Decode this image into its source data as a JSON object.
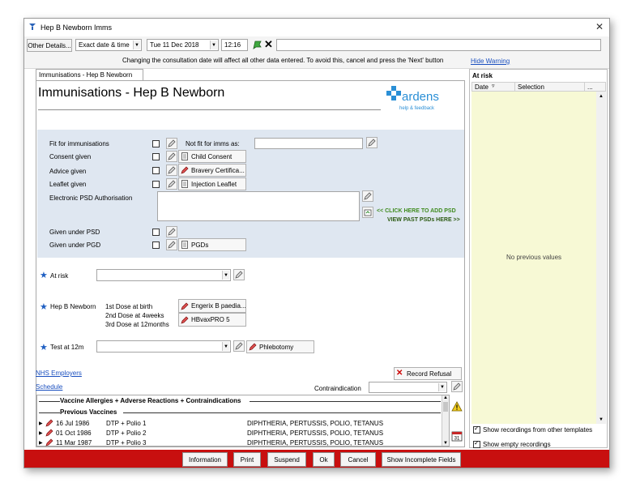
{
  "window": {
    "title": "Hep B Newborn Imms"
  },
  "toolbar": {
    "other_details": "Other Details...",
    "date_mode": "Exact date & time",
    "date": "Tue 11 Dec 2018",
    "time": "12:16",
    "warning": "Changing the consultation date will affect all other data entered. To avoid this, cancel and press the 'Next' button",
    "hide_warning": "Hide Warning"
  },
  "tab": {
    "label": "Immunisations - Hep B Newborn"
  },
  "main": {
    "heading": "Immunisations - Hep B Newborn",
    "brand": {
      "name": "ardens",
      "tagline": "help & feedback"
    },
    "fields": {
      "fit": "Fit for immunisations",
      "not_fit": "Not fit for imms as:",
      "consent": "Consent given",
      "advice": "Advice given",
      "leaflet": "Leaflet given",
      "eauth": "Electronic PSD Authorisation",
      "psd": "Given under PSD",
      "pgd": "Given under PGD"
    },
    "buttons": {
      "child_consent": "Child Consent",
      "bravery": "Bravery Certifica...",
      "injection": "Injection Leaflet",
      "pgds": "PGDs",
      "engerix": "Engerix B paedia...",
      "hbvax": "HBvaxPRO 5",
      "phlebotomy": "Phlebotomy",
      "record_refusal": "Record Refusal"
    },
    "psd_add": "<< CLICK HERE TO ADD PSD",
    "psd_view": "VIEW PAST PSDs HERE >>",
    "at_risk": "At risk",
    "hepb": "Hep B Newborn",
    "doses": [
      "1st Dose at birth",
      "2nd Dose at 4weeks",
      "3rd Dose at 12months"
    ],
    "test": "Test at 12m",
    "nhs_employers": "NHS Employers",
    "schedule": "Schedule",
    "contraindication": "Contraindication"
  },
  "history": {
    "section1": "Vaccine Allergies + Adverse Reactions + Contraindications",
    "section2": "Previous Vaccines",
    "rows": [
      {
        "date": "16 Jul 1986",
        "vaccine": "DTP + Polio 1",
        "desc": "DIPHTHERIA, PERTUSSIS, POLIO, TETANUS"
      },
      {
        "date": "01 Oct 1986",
        "vaccine": "DTP + Polio 2",
        "desc": "DIPHTHERIA, PERTUSSIS, POLIO, TETANUS"
      },
      {
        "date": "11 Mar 1987",
        "vaccine": "DTP + Polio 3",
        "desc": "DIPHTHERIA, PERTUSSIS, POLIO, TETANUS"
      }
    ]
  },
  "right_panel": {
    "title": "At risk",
    "col_date": "Date",
    "col_selection": "Selection",
    "col_more": "...",
    "empty": "No previous values",
    "show_other": "Show recordings from other templates",
    "show_empty": "Show empty recordings"
  },
  "footer": {
    "information": "Information",
    "print": "Print",
    "suspend": "Suspend",
    "ok": "Ok",
    "cancel": "Cancel",
    "incomplete": "Show Incomplete Fields"
  },
  "colors": {
    "footer": "#c80f0f",
    "right_bg": "#f7f9d5",
    "form_bg": "#dfe7f1",
    "brand_blue": "#2a8fd6"
  }
}
